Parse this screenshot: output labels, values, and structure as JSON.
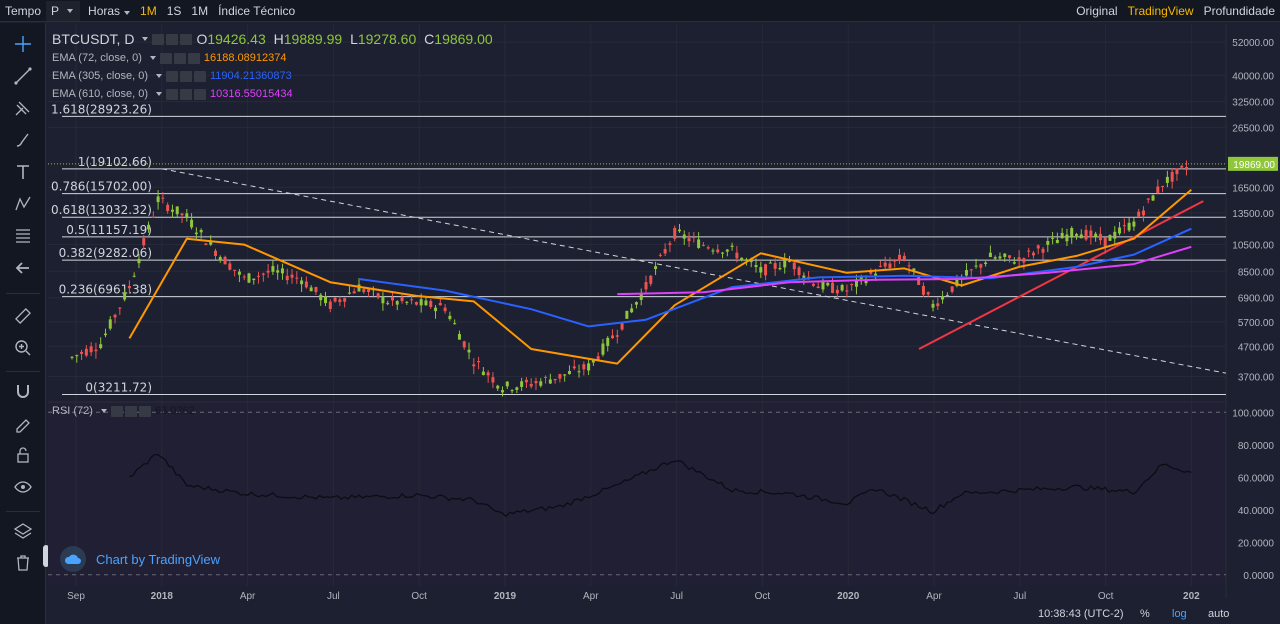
{
  "toolbar": {
    "items": [
      {
        "label": "Tempo"
      },
      {
        "label": "P"
      },
      {
        "label": "Horas"
      },
      {
        "label": "1M"
      },
      {
        "label": "1S"
      },
      {
        "label": "1M"
      },
      {
        "label": "Índice Técnico"
      }
    ],
    "right": [
      {
        "label": "Original"
      },
      {
        "label": "TradingView"
      },
      {
        "label": "Profundidade"
      }
    ]
  },
  "symbol": {
    "name": "BTCUSDT, D",
    "o_label": "O",
    "o": "19426.43",
    "h_label": "H",
    "h": "19889.99",
    "l_label": "L",
    "l": "19278.60",
    "c_label": "C",
    "c": "19869.00"
  },
  "indicators": [
    {
      "label": "EMA (72, close, 0)",
      "value": "16188.08912374",
      "color": "#ff9800"
    },
    {
      "label": "EMA (305, close, 0)",
      "value": "11904.21360873",
      "color": "#2962ff"
    },
    {
      "label": "EMA (610, close, 0)",
      "value": "10316.55015434",
      "color": "#e040fb"
    }
  ],
  "rsi": {
    "label": "RSI (72)",
    "value": "63.0262"
  },
  "watermark": "Chart by TradingView",
  "bottom_bar": {
    "time": "10:38:43 (UTC-2)",
    "percent": "%",
    "log": "log",
    "auto": "auto"
  },
  "colors": {
    "up": "#8fc63b",
    "down": "#ef5350",
    "price_tag": "#8fc63b",
    "trendline_red": "#f23645",
    "ema_orange": "#ff9800",
    "ema_blue": "#2962ff",
    "ema_magenta": "#e040fb"
  },
  "chart_data": [
    {
      "type": "line",
      "scale": "log",
      "x_tick_labels": [
        "Sep",
        "2018",
        "Apr",
        "Jul",
        "Oct",
        "2019",
        "Apr",
        "Jul",
        "Oct",
        "2020",
        "Apr",
        "Jul",
        "Oct",
        "202"
      ],
      "y_tick_labels": [
        "52000.00",
        "40000.00",
        "32500.00",
        "26500.00",
        "16500.00",
        "13500.00",
        "10500.00",
        "8500.00",
        "6900.00",
        "5700.00",
        "4700.00",
        "3700.00"
      ],
      "y_ticks": [
        52000,
        40000,
        32500,
        26500,
        16500,
        13500,
        10500,
        8500,
        6900,
        5700,
        4700,
        3700
      ],
      "last_price": 19869.0,
      "last_price_label": "19869.00",
      "fib_levels": [
        {
          "label": "1.618(28923.26)",
          "value": 28923.26
        },
        {
          "label": "1(19102.66)",
          "value": 19102.66
        },
        {
          "label": "0.786(15702.00)",
          "value": 15702.0
        },
        {
          "label": "0.618(13032.32)",
          "value": 13032.32
        },
        {
          "label": "0.5(11157.19)",
          "value": 11157.19
        },
        {
          "label": "0.382(9282.06)",
          "value": 9282.06
        },
        {
          "label": "0.236(6961.38)",
          "value": 6961.38
        },
        {
          "label": "0(3211.72)",
          "value": 3211.72
        }
      ],
      "price_months": [
        "2017-09",
        "2017-10",
        "2017-11",
        "2017-12",
        "2018-01",
        "2018-02",
        "2018-03",
        "2018-04",
        "2018-05",
        "2018-06",
        "2018-07",
        "2018-08",
        "2018-09",
        "2018-10",
        "2018-11",
        "2018-12",
        "2019-01",
        "2019-02",
        "2019-03",
        "2019-04",
        "2019-05",
        "2019-06",
        "2019-07",
        "2019-08",
        "2019-09",
        "2019-10",
        "2019-11",
        "2019-12",
        "2020-01",
        "2020-02",
        "2020-03",
        "2020-04",
        "2020-05",
        "2020-06",
        "2020-07",
        "2020-08",
        "2020-09",
        "2020-10",
        "2020-11",
        "2020-12"
      ],
      "price_values": [
        4300,
        4800,
        7500,
        15000,
        13000,
        10000,
        8000,
        8500,
        8000,
        6500,
        7500,
        6700,
        6600,
        6400,
        4200,
        3400,
        3500,
        3700,
        4000,
        5300,
        7500,
        11500,
        10500,
        10000,
        8500,
        9200,
        7600,
        7300,
        8500,
        9500,
        6500,
        8000,
        9500,
        9300,
        10500,
        11700,
        10800,
        12500,
        17000,
        19869
      ],
      "series": [
        {
          "name": "EMA (72, close, 0)",
          "x": [
            "2017-11",
            "2018-01",
            "2018-03",
            "2018-06",
            "2018-09",
            "2018-11",
            "2019-01",
            "2019-04",
            "2019-06",
            "2019-09",
            "2019-12",
            "2020-02",
            "2020-04",
            "2020-06",
            "2020-08",
            "2020-10",
            "2020-12"
          ],
          "y": [
            5000,
            11000,
            10500,
            7800,
            7000,
            6700,
            4600,
            4100,
            6500,
            9800,
            8400,
            8700,
            7600,
            8800,
            9600,
            11000,
            16188
          ]
        },
        {
          "name": "EMA (305, close, 0)",
          "x": [
            "2018-07",
            "2018-10",
            "2019-01",
            "2019-03",
            "2019-05",
            "2019-08",
            "2019-11",
            "2020-02",
            "2020-05",
            "2020-08",
            "2020-10",
            "2020-12"
          ],
          "y": [
            8000,
            7300,
            6300,
            5500,
            5800,
            7500,
            8100,
            8200,
            8050,
            8800,
            9700,
            11904
          ]
        },
        {
          "name": "EMA (610, close, 0)",
          "x": [
            "2019-04",
            "2019-07",
            "2019-10",
            "2020-01",
            "2020-04",
            "2020-07",
            "2020-10",
            "2020-12"
          ],
          "y": [
            7100,
            7200,
            7800,
            7950,
            8000,
            8400,
            9000,
            10316
          ]
        }
      ]
    },
    {
      "type": "line",
      "title": "RSI (72)",
      "y_tick_labels": [
        "100.0000",
        "80.0000",
        "60.0000",
        "40.0000",
        "20.0000",
        "0.0000"
      ],
      "y_ticks": [
        100,
        80,
        60,
        40,
        20,
        0
      ],
      "ylim": [
        0,
        100
      ],
      "x": [
        "2017-11",
        "2017-12",
        "2018-01",
        "2018-03",
        "2018-06",
        "2018-09",
        "2018-11",
        "2018-12",
        "2019-02",
        "2019-04",
        "2019-06",
        "2019-08",
        "2019-10",
        "2019-12",
        "2020-01",
        "2020-03",
        "2020-04",
        "2020-06",
        "2020-08",
        "2020-10",
        "2020-11",
        "2020-12"
      ],
      "y": [
        60,
        75,
        55,
        50,
        47,
        49,
        46,
        37,
        42,
        55,
        71,
        52,
        50,
        44,
        53,
        39,
        50,
        52,
        54,
        51,
        68,
        63
      ]
    }
  ]
}
